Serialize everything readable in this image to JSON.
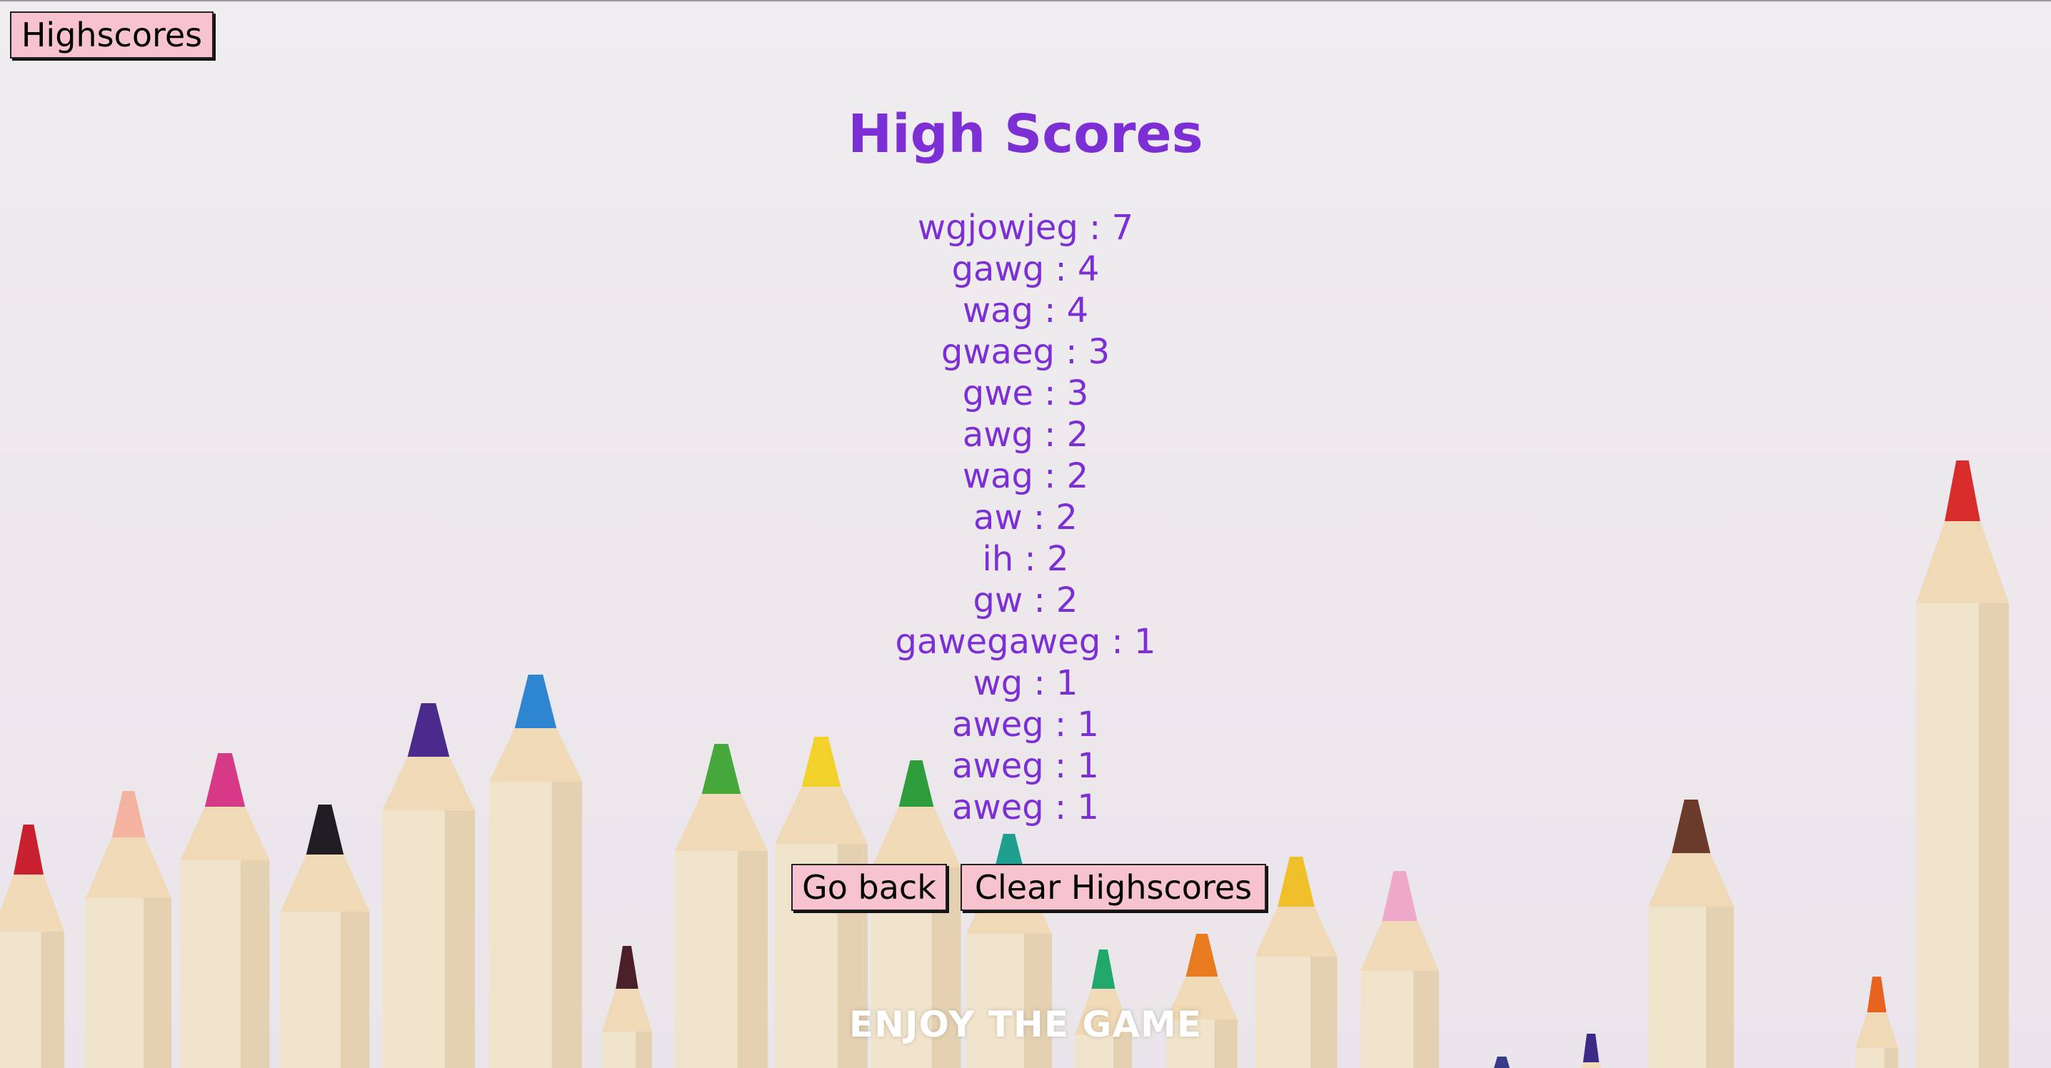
{
  "nav": {
    "highscores_label": "Highscores"
  },
  "page": {
    "title": "High Scores",
    "footer_text": "ENJOY THE GAME"
  },
  "scores": [
    {
      "name": "wgjowjeg",
      "score": 7,
      "text": "wgjowjeg : 7"
    },
    {
      "name": "gawg",
      "score": 4,
      "text": "gawg : 4"
    },
    {
      "name": "wag",
      "score": 4,
      "text": "wag : 4"
    },
    {
      "name": "gwaeg",
      "score": 3,
      "text": "gwaeg : 3"
    },
    {
      "name": "gwe",
      "score": 3,
      "text": "gwe : 3"
    },
    {
      "name": "awg",
      "score": 2,
      "text": "awg : 2"
    },
    {
      "name": "wag",
      "score": 2,
      "text": "wag : 2"
    },
    {
      "name": "aw",
      "score": 2,
      "text": "aw : 2"
    },
    {
      "name": "ih",
      "score": 2,
      "text": "ih : 2"
    },
    {
      "name": "gw",
      "score": 2,
      "text": "gw : 2"
    },
    {
      "name": "gawegaweg",
      "score": 1,
      "text": "gawegaweg : 1"
    },
    {
      "name": "wg",
      "score": 1,
      "text": "wg : 1"
    },
    {
      "name": "aweg",
      "score": 1,
      "text": "aweg : 1"
    },
    {
      "name": "aweg",
      "score": 1,
      "text": "aweg : 1"
    },
    {
      "name": "aweg",
      "score": 1,
      "text": "aweg : 1"
    }
  ],
  "actions": {
    "back_label": "Go back",
    "clear_label": "Clear Highscores"
  },
  "colors": {
    "accent": "#7d2fd6",
    "button_bg": "#f7c3cf",
    "background": "#ece8ec",
    "footer_text": "#ffffff"
  },
  "background_image": {
    "subject": "colored-pencils-row",
    "pencil_tip_colors": [
      "#c8202f",
      "#f3b3a0",
      "#d63a86",
      "#1f1d21",
      "#4a2a8c",
      "#2f86d0",
      "#4a1f2a",
      "#46a83a",
      "#f1d12a",
      "#2e9e3c",
      "#1fa08e",
      "#20a86a",
      "#e87a1f",
      "#f0c02a",
      "#f0a8c8",
      "#3a3a8a",
      "#3b2a88",
      "#6a3a2a",
      "#e8621f",
      "#d82b2b"
    ]
  }
}
